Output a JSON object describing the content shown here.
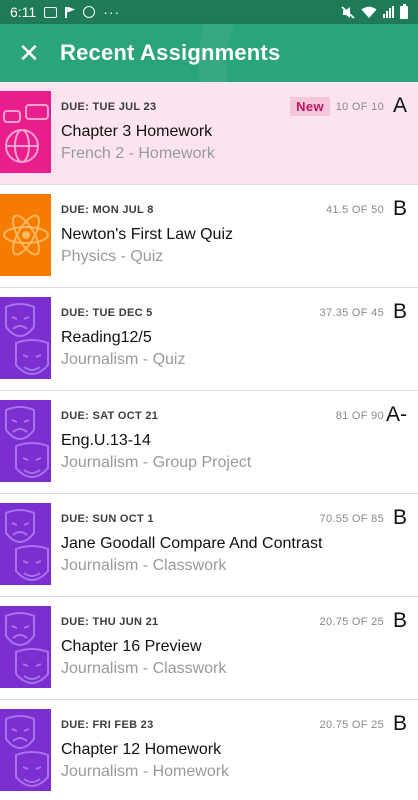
{
  "status_bar": {
    "time": "6:11",
    "more": "···"
  },
  "app_bar": {
    "close_glyph": "✕",
    "title": "Recent Assignments",
    "color": "#2aa47a"
  },
  "assignments": [
    {
      "due": "DUE: TUE JUL 23",
      "badge": "New",
      "score": "10 OF 10",
      "grade": "A",
      "title": "Chapter 3 Homework",
      "subtitle": "French 2 - Homework",
      "thumb": "language-icon",
      "thumb_color": "#e91e8c",
      "highlight_color": "#fbe4ef"
    },
    {
      "due": "DUE: MON JUL 8",
      "score": "41.5 OF 50",
      "grade": "B",
      "title": "Newton's First Law Quiz",
      "subtitle": "Physics - Quiz",
      "thumb": "atom-icon",
      "thumb_color": "#f57c00"
    },
    {
      "due": "DUE: TUE DEC 5",
      "score": "37.35 OF 45",
      "grade": "B",
      "title": "Reading12/5",
      "subtitle": "Journalism - Quiz",
      "thumb": "theater-masks-icon",
      "thumb_color": "#7b2fd0"
    },
    {
      "due": "DUE: SAT OCT 21",
      "score": "81 OF 90",
      "grade": "A-",
      "title": "Eng.U.13-14",
      "subtitle": "Journalism - Group Project",
      "thumb": "theater-masks-icon",
      "thumb_color": "#7b2fd0"
    },
    {
      "due": "DUE: SUN OCT 1",
      "score": "70.55 OF 85",
      "grade": "B",
      "title": "Jane Goodall Compare And Contrast",
      "subtitle": "Journalism - Classwork",
      "thumb": "theater-masks-icon",
      "thumb_color": "#7b2fd0"
    },
    {
      "due": "DUE: THU JUN 21",
      "score": "20.75 OF 25",
      "grade": "B",
      "title": "Chapter 16 Preview",
      "subtitle": "Journalism - Classwork",
      "thumb": "theater-masks-icon",
      "thumb_color": "#7b2fd0"
    },
    {
      "due": "DUE: FRI FEB 23",
      "score": "20.75 OF 25",
      "grade": "B",
      "title": "Chapter 12 Homework",
      "subtitle": "Journalism - Homework",
      "thumb": "theater-masks-icon",
      "thumb_color": "#7b2fd0"
    }
  ]
}
